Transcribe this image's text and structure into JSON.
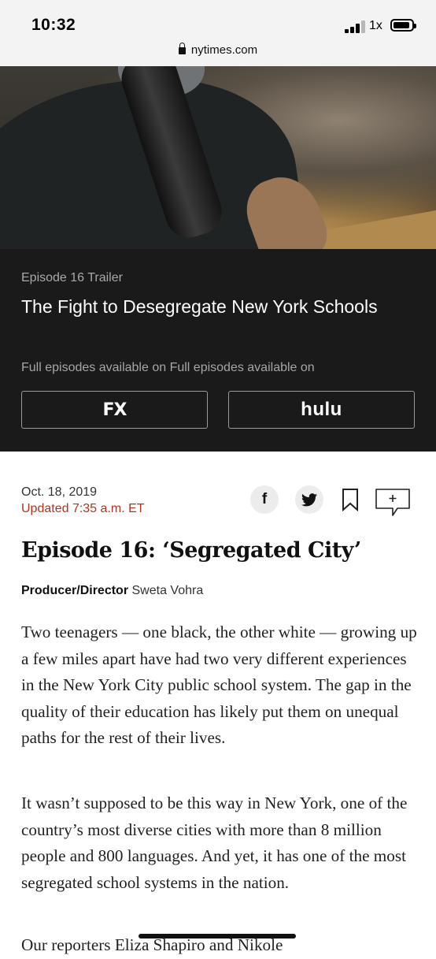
{
  "status_bar": {
    "time": "10:32",
    "zoom": "1x",
    "url": "nytimes.com"
  },
  "video": {
    "episode_label": "Episode 16 Trailer",
    "title": "The Fight to Desegregate New York Schools"
  },
  "availability": {
    "text": "Full episodes available on Full episodes available on",
    "fx_label": "FX",
    "hulu_label": "hulu"
  },
  "article": {
    "date": "Oct. 18, 2019",
    "updated": "Updated 7:35 a.m. ET",
    "share": {
      "facebook_icon": "f"
    },
    "headline": "Episode 16: ‘Segregated City’",
    "byline_role": "Producer/Director",
    "byline_name": "Sweta Vohra",
    "paragraphs": [
      "Two teenagers — one black, the other white — growing up a few miles apart have had two very different experiences in the New York City public school system. The gap in the quality of their education has likely put them on unequal paths for the rest of their lives.",
      "It wasn’t supposed to be this way in New York, one of the country’s most diverse cities with more than 8 million people and 800 languages. And yet, it has one of the most segregated school systems in the nation.",
      "Our reporters Eliza Shapiro and Nikole"
    ]
  },
  "colors": {
    "updated": "#b3341a",
    "panel": "#1a1a1a"
  },
  "icons": [
    "lock-icon",
    "signal-icon",
    "battery-icon",
    "facebook-icon",
    "twitter-icon",
    "bookmark-icon",
    "comment-icon"
  ]
}
